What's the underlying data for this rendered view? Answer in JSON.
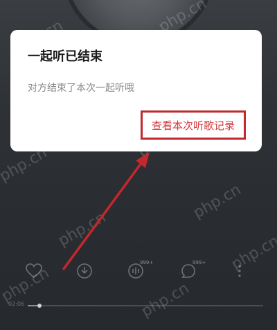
{
  "dialog": {
    "title": "一起听已结束",
    "message": "对方结束了本次一起听哦",
    "action_label": "查看本次听歌记录"
  },
  "player": {
    "controls": [
      {
        "name": "like-heart-icon",
        "badge": ""
      },
      {
        "name": "download-icon",
        "badge": ""
      },
      {
        "name": "sound-effect-icon",
        "badge": "999+"
      },
      {
        "name": "comment-icon",
        "badge": "999+"
      },
      {
        "name": "more-vertical-icon",
        "badge": ""
      }
    ],
    "current_time": "02:06",
    "progress": 0.05
  },
  "watermark": "php.cn",
  "colors": {
    "accent_red": "#c2282d",
    "dialog_bg": "#ffffff",
    "backdrop": "#2b2e33"
  }
}
